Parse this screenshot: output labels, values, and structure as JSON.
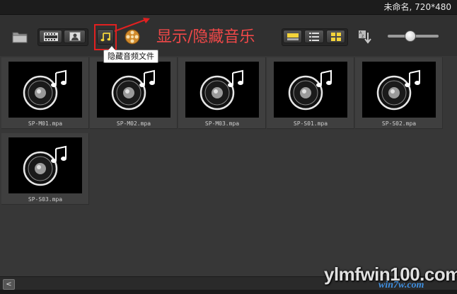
{
  "header": {
    "project_info": "未命名, 720*480"
  },
  "toolbar": {
    "tooltip": "隐藏音频文件",
    "annotation": "显示/隐藏音乐"
  },
  "clips": [
    {
      "name": "SP-M01.mpa"
    },
    {
      "name": "SP-M02.mpa"
    },
    {
      "name": "SP-M03.mpa"
    },
    {
      "name": "SP-S01.mpa"
    },
    {
      "name": "SP-S02.mpa"
    },
    {
      "name": "SP-S03.mpa"
    }
  ],
  "footer": {
    "scroll_left": "<"
  },
  "watermark": {
    "main": "ylmfwin100.com",
    "sub": "win7w.com"
  },
  "colors": {
    "annotation": "#f04848",
    "highlight": "#e12020",
    "background": "#3a3a3a"
  },
  "icons": [
    "folder-icon",
    "filmstrip-icon",
    "image-icon",
    "music-note-icon",
    "film-reel-icon",
    "storyboard-view-icon",
    "list-view-icon",
    "thumbnail-view-icon",
    "sort-icon",
    "audio-file-icon"
  ]
}
